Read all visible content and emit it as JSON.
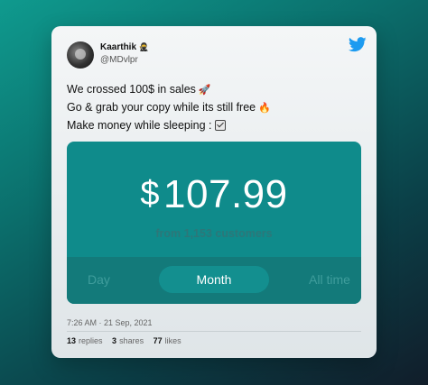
{
  "author": {
    "name": "Kaarthik",
    "name_emoji": "🥷",
    "handle": "@MDvlpr"
  },
  "tweet": {
    "lines": [
      {
        "text": "We crossed 100$ in sales",
        "emoji": "🚀"
      },
      {
        "text": "Go & grab your copy while its still free",
        "emoji": "🔥"
      },
      {
        "text": "Make money while sleeping :",
        "emoji": "☑️"
      }
    ]
  },
  "sales_widget": {
    "currency_symbol": "$",
    "amount": "107.99",
    "subtitle": "from 1,153 customers",
    "tabs": [
      "Day",
      "Month",
      "All time"
    ],
    "active_tab": "Month"
  },
  "meta": {
    "timestamp": "7:26 AM · 21 Sep, 2021",
    "replies_count": "13",
    "replies_label": "replies",
    "shares_count": "3",
    "shares_label": "shares",
    "likes_count": "77",
    "likes_label": "likes"
  },
  "icons": {
    "brand": "twitter-bird-icon",
    "brand_color": "#1d9bf0",
    "accent_color": "#0f8b8b"
  }
}
